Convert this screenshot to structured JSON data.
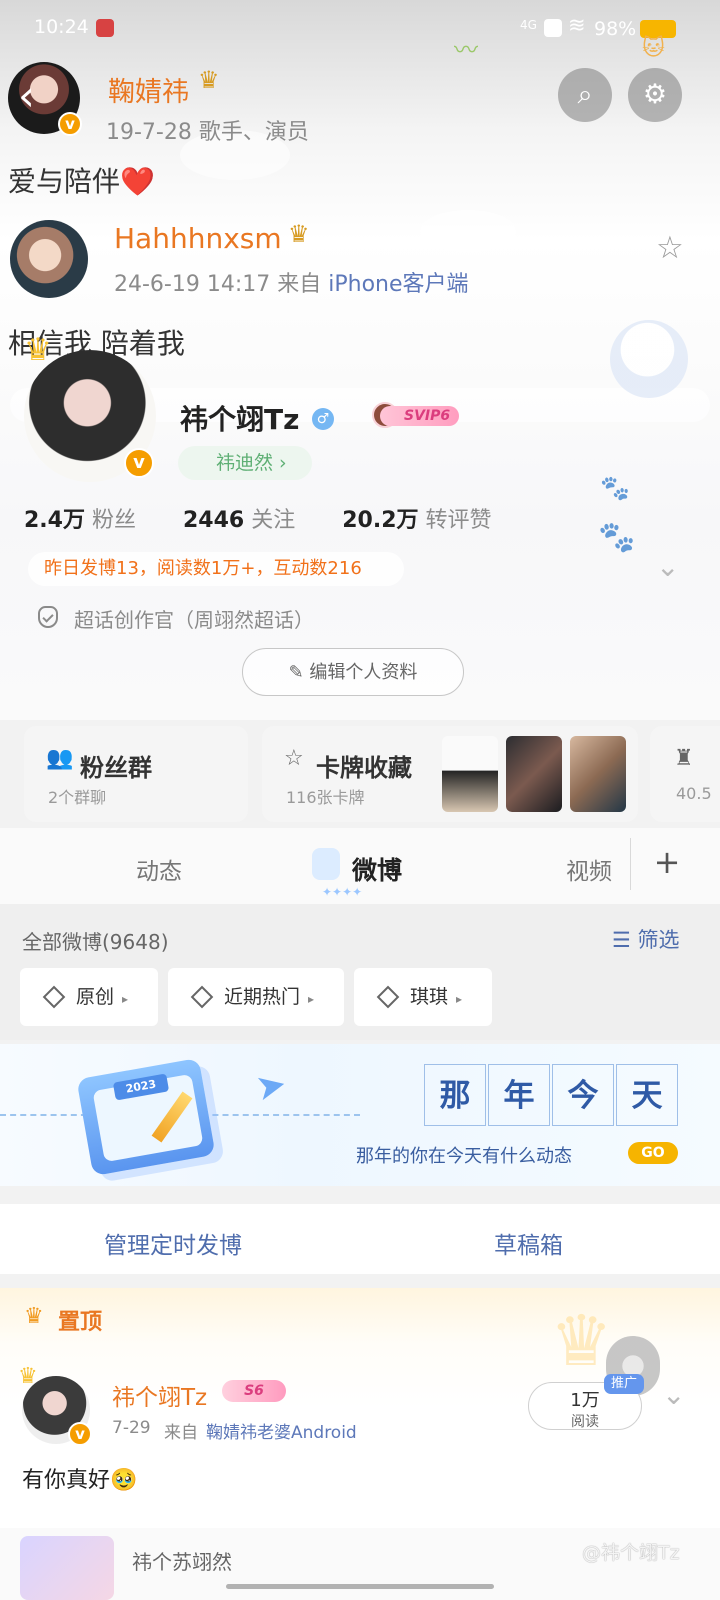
{
  "status_bar": {
    "time": "10:24",
    "battery": "98%"
  },
  "top_post": {
    "name": "鞠婧祎",
    "date_role": "19-7-28  歌手、演员",
    "content": "爱与陪伴❤️"
  },
  "second_post": {
    "name": "Hahhhnxsm",
    "meta_prefix": "24-6-19 14:17  来自 ",
    "source": "iPhone客户端",
    "content": "相信我 陪着我"
  },
  "profile": {
    "name": "祎个翊Tz",
    "svip": "SVIP6",
    "green_label": "祎迪然",
    "stats": {
      "fans_num": "2.4万",
      "fans_label": "粉丝",
      "follow_num": "2446",
      "follow_label": "关注",
      "likes_num": "20.2万",
      "likes_label": "转评赞"
    },
    "notice": "昨日发博13，阅读数1万+，互动数216",
    "super_topic": "超话创作官（周翊然超话）",
    "edit_button": "编辑个人资料"
  },
  "cards": {
    "fans_group_title": "粉丝群",
    "fans_group_sub": "2个群聊",
    "card_collection_title": "卡牌收藏",
    "card_collection_sub": "116张卡牌",
    "third_sub": "40.5"
  },
  "tabs": {
    "dynamic": "动态",
    "weibo": "微博",
    "video": "视频",
    "plus": "+"
  },
  "filters": {
    "all_weibo": "全部微博(9648)",
    "filter": "筛选",
    "chip1": "原创",
    "chip2": "近期热门",
    "chip3": "琪琪"
  },
  "memory_banner": {
    "calendar_year": "2023",
    "title_chars": [
      "那",
      "年",
      "今",
      "天"
    ],
    "subtitle": "那年的你在今天有什么动态",
    "go": "GO"
  },
  "actions": {
    "scheduled": "管理定时发博",
    "drafts": "草稿箱"
  },
  "pinned": {
    "label": "置顶",
    "name": "祎个翊Tz",
    "badge": "S6",
    "date": "7-29",
    "from": "来自",
    "source": "鞠婧祎老婆Android",
    "content": "有你真好🥹",
    "read_count": "1万",
    "read_label": "阅读",
    "promo": "推广"
  },
  "bottom": {
    "preview_text": "祎个苏翊然",
    "watermark": "@祎个翊Tz"
  },
  "colors": {
    "orange": "#e97722",
    "blue": "#4f6dad",
    "gold": "#f6b400"
  }
}
